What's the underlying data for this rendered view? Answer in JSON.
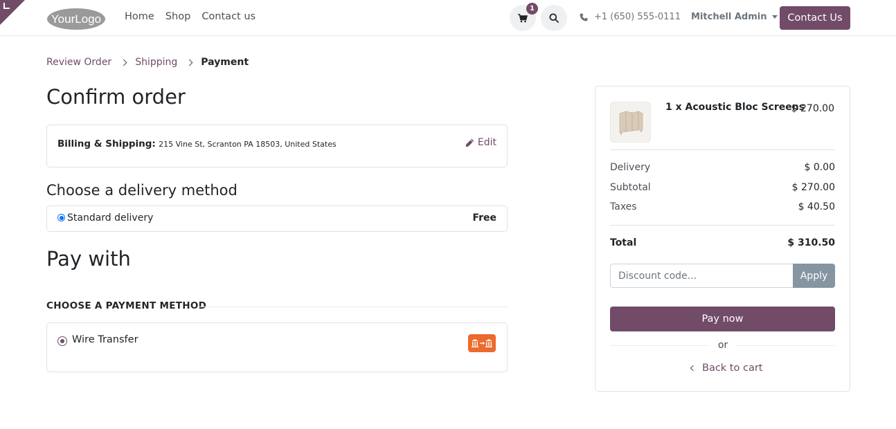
{
  "header": {
    "logo_text": "YourLogo",
    "nav": [
      "Home",
      "Shop",
      "Contact us"
    ],
    "cart_count": "1",
    "phone": "+1 (650) 555-0111",
    "user_name": "Mitchell Admin",
    "contact_button": "Contact Us"
  },
  "breadcrumb": {
    "review": "Review Order",
    "shipping": "Shipping",
    "payment": "Payment"
  },
  "confirm": {
    "title": "Confirm order",
    "address_label": "Billing & Shipping:",
    "address_value": "215 Vine St, Scranton PA 18503, United States",
    "edit_label": "Edit"
  },
  "delivery": {
    "title": "Choose a delivery method",
    "method": "Standard delivery",
    "price": "Free"
  },
  "payment": {
    "title": "Pay with",
    "subtitle": "CHOOSE A PAYMENT METHOD",
    "method": "Wire Transfer",
    "icon": "bank-transfer-icon"
  },
  "summary": {
    "product_name": "1 x Acoustic Bloc Screens",
    "product_price": "$ 270.00",
    "delivery_label": "Delivery",
    "delivery_value": "$ 0.00",
    "subtotal_label": "Subtotal",
    "subtotal_value": "$ 270.00",
    "taxes_label": "Taxes",
    "taxes_value": "$ 40.50",
    "total_label": "Total",
    "total_value": "$ 310.50",
    "discount_placeholder": "Discount code...",
    "apply_label": "Apply",
    "pay_label": "Pay now",
    "or_label": "or",
    "back_label": "Back to cart"
  },
  "colors": {
    "brand": "#714B67",
    "apply": "#8595a2",
    "wire_icon_bg": "#ec6a2c",
    "radio_blue": "#0d6efd"
  }
}
